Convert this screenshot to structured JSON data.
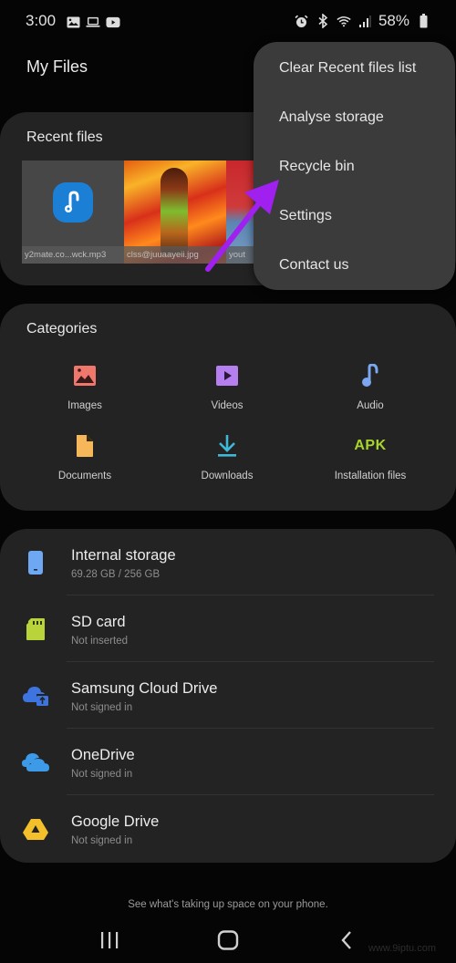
{
  "status_bar": {
    "time": "3:00",
    "left_icons": [
      "gallery-icon",
      "laptop-icon",
      "youtube-icon"
    ],
    "right_icons": [
      "alarm-icon",
      "bluetooth-icon",
      "wifi-icon",
      "signal-icon"
    ],
    "battery": "58%"
  },
  "header": {
    "title": "My Files"
  },
  "recent": {
    "title": "Recent files",
    "files": [
      {
        "name": "y2mate.co...wck.mp3",
        "type": "audio"
      },
      {
        "name": "clss@juuaayeii.jpg",
        "type": "image"
      },
      {
        "name": "yout",
        "type": "image"
      }
    ]
  },
  "menu": {
    "items": [
      {
        "label": "Clear Recent files list"
      },
      {
        "label": "Analyse storage"
      },
      {
        "label": "Recycle bin"
      },
      {
        "label": "Settings"
      },
      {
        "label": "Contact us"
      }
    ]
  },
  "annotation": {
    "arrow_color": "#a020f0",
    "points_to": "Recycle bin"
  },
  "categories": {
    "title": "Categories",
    "items": [
      {
        "label": "Images",
        "icon": "image-icon",
        "color": "#f0776b"
      },
      {
        "label": "Videos",
        "icon": "video-icon",
        "color": "#b67ff0"
      },
      {
        "label": "Audio",
        "icon": "music-note-icon",
        "color": "#7aa7f0"
      },
      {
        "label": "Documents",
        "icon": "document-icon",
        "color": "#f5b75a"
      },
      {
        "label": "Downloads",
        "icon": "download-icon",
        "color": "#3fb7d6"
      },
      {
        "label": "Installation files",
        "icon": "apk-icon",
        "icon_text": "APK",
        "color": "#a9d42c"
      }
    ]
  },
  "storage": {
    "items": [
      {
        "name": "Internal storage",
        "sub": "69.28 GB / 256 GB",
        "icon": "phone-storage-icon",
        "color": "#6fa8f2"
      },
      {
        "name": "SD card",
        "sub": "Not inserted",
        "icon": "sd-card-icon",
        "color": "#b8d43a"
      },
      {
        "name": "Samsung Cloud Drive",
        "sub": "Not signed in",
        "icon": "samsung-cloud-icon",
        "color": "#3d74e0"
      },
      {
        "name": "OneDrive",
        "sub": "Not signed in",
        "icon": "onedrive-icon",
        "color": "#3d9ae8"
      },
      {
        "name": "Google Drive",
        "sub": "Not signed in",
        "icon": "google-drive-icon",
        "color": "#f3c02c"
      }
    ]
  },
  "footer": {
    "hint": "See what's taking up space on your phone."
  },
  "nav": {
    "recents": "recents-icon",
    "home": "home-icon",
    "back": "back-icon"
  },
  "watermark": "www.9iptu.com"
}
